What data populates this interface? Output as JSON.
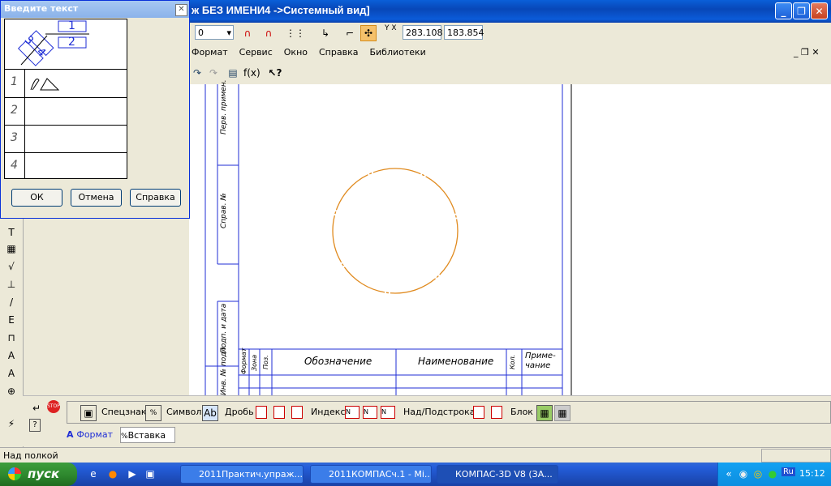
{
  "window": {
    "title": "ж БЕЗ ИМЕНИ4 ->Системный вид]"
  },
  "toolbar": {
    "style_value": "0",
    "x_label": "Y X",
    "coord_x": "283.108",
    "coord_y": "183.854"
  },
  "menu": [
    "Формат",
    "Сервис",
    "Окно",
    "Справка",
    "Библиотеки"
  ],
  "dialog": {
    "title": "Введите текст",
    "frac_numerator": "1",
    "frac_denominator": "2",
    "frac_left_top": "3",
    "frac_left_bottom": "4",
    "row_numbers": [
      "1",
      "2",
      "3",
      "4"
    ],
    "ok_label": "ОК",
    "cancel_label": "Отмена",
    "help_label": "Справка"
  },
  "title_block": {
    "side_labels": [
      "Перв. примен.",
      "Справ. №",
      "Подп. и дата",
      "Инв. № подл."
    ],
    "headers": [
      "Формат",
      "Зона",
      "Поз.",
      "Обозначение",
      "Наименование",
      "Кол.",
      "Приме-чание"
    ]
  },
  "panel": {
    "specsign": "Спецзнак",
    "symbol": "Символ",
    "fraction": "Дробь",
    "index": "Индекс",
    "above_below": "Над/Подстрока",
    "block": "Блок",
    "tab_format": "Формат",
    "tab_insert": "Вставка"
  },
  "status": {
    "text": "Над полкой"
  },
  "taskbar": {
    "start": "пуск",
    "tasks": [
      "2011Практич.упраж...",
      "2011КОМПАСч.1 - Mi...",
      "КОМПАС-3D V8 (ЗА..."
    ],
    "lang": "Ru",
    "clock": "15:12"
  },
  "colors": {
    "circle": "#e08a1e",
    "frame": "#1f2ed6",
    "titlebar": "#0a5fd8"
  }
}
